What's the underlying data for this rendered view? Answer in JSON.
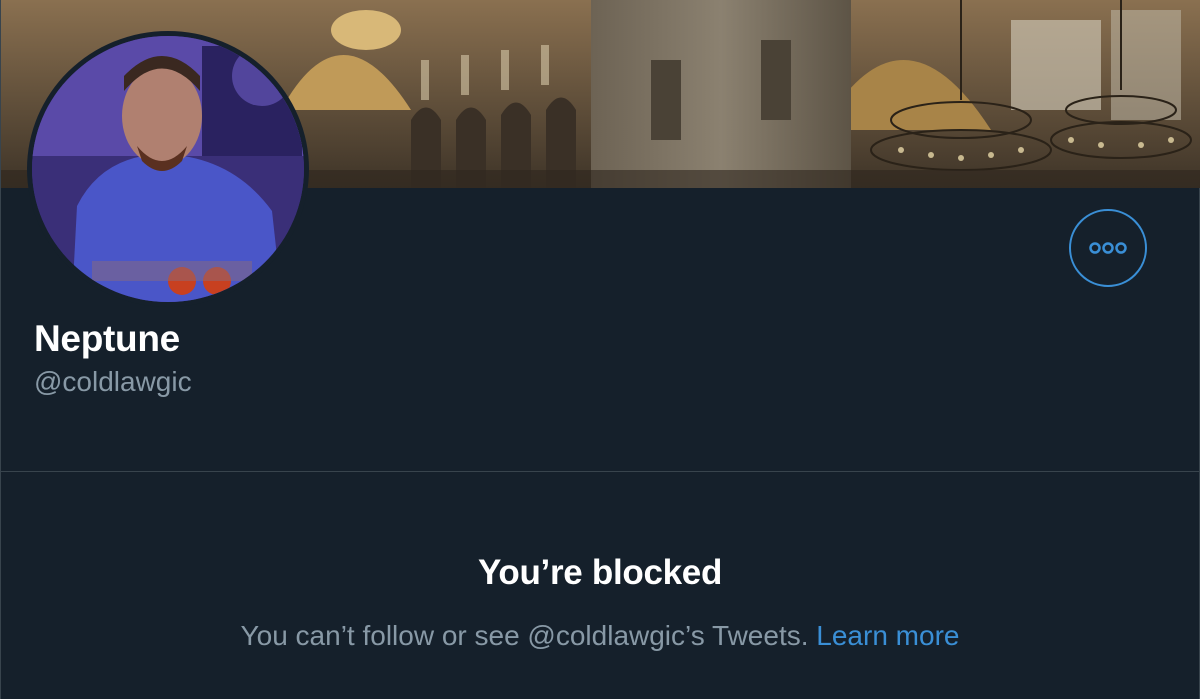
{
  "profile": {
    "display_name": "Neptune",
    "handle": "@coldlawgic",
    "banner_image": "Hagia Sophia interior photo",
    "avatar_image": "profile photo of man in blue shirt"
  },
  "actions": {
    "more_icon": "more-horizontal-icon"
  },
  "blocked": {
    "title": "You’re blocked",
    "message": "You can’t follow or see @coldlawgic’s Tweets.",
    "learn_more_label": "Learn more"
  },
  "colors": {
    "background": "#15202b",
    "accent": "#3a8fd6",
    "secondary_text": "#8899a6",
    "divider": "#38444d"
  }
}
